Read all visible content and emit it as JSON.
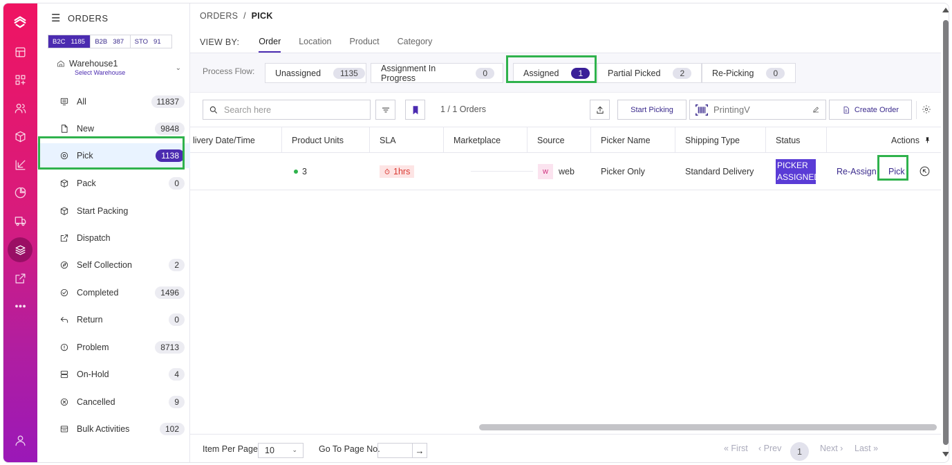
{
  "colors": {
    "brand": "#4b2bb0",
    "rail_top": "#ef1462",
    "rail_bottom": "#9a18b8",
    "highlight": "#2fb24c",
    "sla_red": "#d9372f",
    "status_bg": "#5a3cd6"
  },
  "rail": {
    "icons": [
      "logo-icon",
      "grid-icon",
      "dashboard-icon",
      "users-icon",
      "box-icon",
      "inbound-icon",
      "pie-chart-icon",
      "truck-icon",
      "layers-icon",
      "external-link-icon",
      "more-icon",
      "user-icon"
    ]
  },
  "sidebar": {
    "title": "ORDERS",
    "channels": [
      {
        "label": "B2C",
        "count": "1185",
        "active": true
      },
      {
        "label": "B2B",
        "count": "387"
      },
      {
        "label": "STO",
        "count": "91"
      }
    ],
    "warehouse": {
      "name": "Warehouse1",
      "sub": "Select Warehouse"
    },
    "items": [
      {
        "label": "All",
        "count": "11837",
        "icon": "all-icon"
      },
      {
        "label": "New",
        "count": "9848",
        "icon": "new-icon"
      },
      {
        "label": "Pick",
        "count": "1138",
        "icon": "pick-icon",
        "active": true
      },
      {
        "label": "Pack",
        "count": "0",
        "icon": "pack-icon"
      },
      {
        "label": "Start Packing",
        "count": "",
        "icon": "start-packing-icon"
      },
      {
        "label": "Dispatch",
        "count": "",
        "icon": "dispatch-icon"
      },
      {
        "label": "Self Collection",
        "count": "2",
        "icon": "self-collection-icon"
      },
      {
        "label": "Completed",
        "count": "1496",
        "icon": "completed-icon"
      },
      {
        "label": "Return",
        "count": "0",
        "icon": "return-icon"
      },
      {
        "label": "Problem",
        "count": "8713",
        "icon": "problem-icon"
      },
      {
        "label": "On-Hold",
        "count": "4",
        "icon": "on-hold-icon"
      },
      {
        "label": "Cancelled",
        "count": "9",
        "icon": "cancelled-icon"
      },
      {
        "label": "Bulk Activities",
        "count": "102",
        "icon": "bulk-activities-icon"
      }
    ]
  },
  "breadcrumb": {
    "root": "ORDERS",
    "sep": "/",
    "current": "PICK"
  },
  "viewby": {
    "label": "VIEW BY:",
    "tabs": [
      "Order",
      "Location",
      "Product",
      "Category"
    ],
    "active": "Order"
  },
  "process_flow": {
    "label": "Process Flow:",
    "steps": [
      {
        "label": "Unassigned",
        "count": "1135"
      },
      {
        "label": "Assignment In Progress",
        "count": "0"
      },
      {
        "label": "Assigned",
        "count": "1",
        "active": true
      },
      {
        "label": "Partial Picked",
        "count": "2"
      },
      {
        "label": "Re-Picking",
        "count": "0"
      }
    ]
  },
  "toolbar": {
    "search_placeholder": "Search here",
    "orders_count": "1 / 1 Orders",
    "start_picking": "Start Picking",
    "printer": "PrintingV",
    "create_order": "Create Order"
  },
  "table": {
    "columns": [
      "livery Date/Time",
      "Product Units",
      "SLA",
      "Marketplace",
      "Source",
      "Picker Name",
      "Shipping Type",
      "Status",
      "Actions"
    ],
    "rows": [
      {
        "delivery": "",
        "units": "3",
        "sla": "1hrs",
        "marketplace": "",
        "source_badge": "w",
        "source": "web",
        "picker": "Picker Only",
        "shipping": "Standard Delivery",
        "status_line1": "PICKER",
        "status_line2": "ASSIGNED",
        "action_reassign": "Re-Assign",
        "action_pick": "Pick"
      }
    ]
  },
  "footer": {
    "items_per_page_label": "Item Per Page",
    "items_per_page": "10",
    "goto_label": "Go To Page No.",
    "first": "« First",
    "prev": "‹ Prev",
    "page": "1",
    "next": "Next ›",
    "last": "Last »"
  }
}
